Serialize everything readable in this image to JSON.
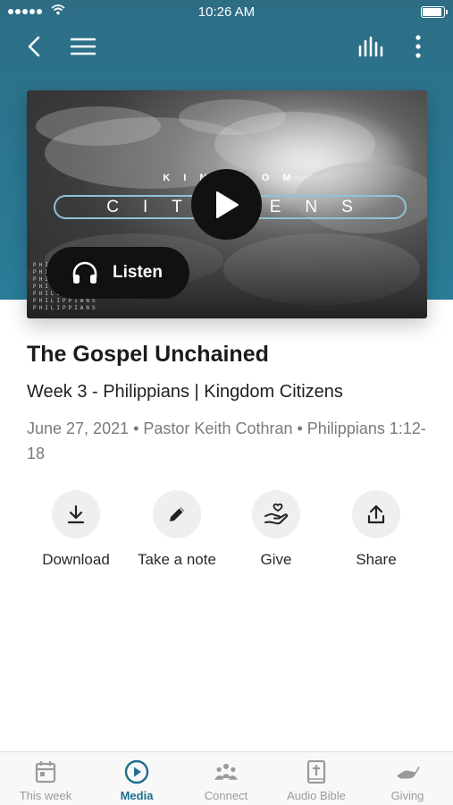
{
  "status_bar": {
    "time": "10:26 AM"
  },
  "nav": {
    "back_icon": "chevron-left-icon",
    "menu_icon": "hamburger-menu-icon",
    "audio_icon": "audio-bars-icon",
    "more_icon": "more-vertical-icon"
  },
  "artwork": {
    "kicker": "KINGDOM",
    "series_title": "CITIZENS",
    "vertical_text": [
      "PHILIPPIANS",
      "PHILIPPIANS",
      "PHILIPPIANS",
      "PHILIPPIANS",
      "PHILIPPIANS",
      "PHILIPPIANS",
      "PHILIPPIANS"
    ],
    "play_icon": "play-icon",
    "listen_label": "Listen",
    "listen_icon": "headphones-icon"
  },
  "sermon": {
    "title": "The Gospel Unchained",
    "subtitle": "Week 3 - Philippians | Kingdom Citizens",
    "meta": "June 27, 2021 • Pastor Keith Cothran • Philippians 1:12-18"
  },
  "actions": [
    {
      "label": "Download",
      "icon": "download-icon"
    },
    {
      "label": "Take a note",
      "icon": "pencil-icon"
    },
    {
      "label": "Give",
      "icon": "give-hand-heart-icon"
    },
    {
      "label": "Share",
      "icon": "share-icon"
    }
  ],
  "tabs": [
    {
      "label": "This week",
      "icon": "calendar-icon",
      "active": false
    },
    {
      "label": "Media",
      "icon": "play-circle-icon",
      "active": true
    },
    {
      "label": "Connect",
      "icon": "people-icon",
      "active": false
    },
    {
      "label": "Audio Bible",
      "icon": "bible-icon",
      "active": false
    },
    {
      "label": "Giving",
      "icon": "hand-icon",
      "active": false
    }
  ],
  "colors": {
    "header_teal": "#2b7691",
    "active_tab": "#1e6f8c",
    "inactive_tab": "#9a9a9a",
    "action_circle": "#efefef"
  }
}
